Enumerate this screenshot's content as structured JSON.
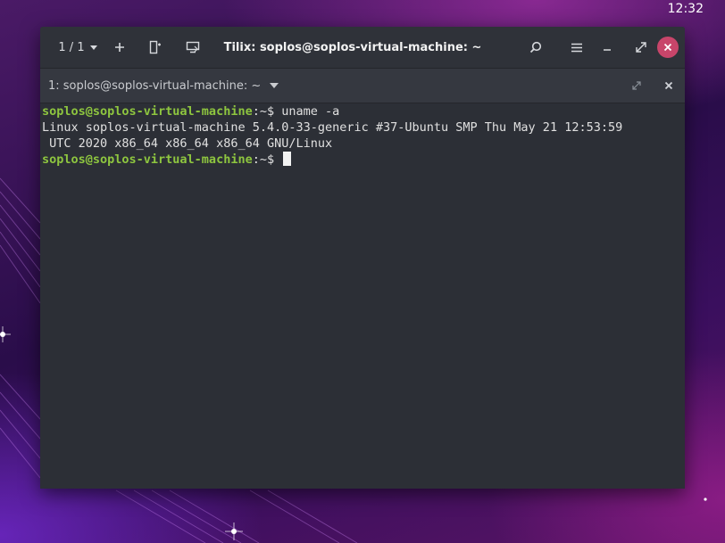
{
  "desktop": {
    "clock": "12:32"
  },
  "titlebar": {
    "session_count": "1 / 1",
    "title": "Tilix: soplos@soplos-virtual-machine: ~"
  },
  "terminal_header": {
    "title": "1: soplos@soplos-virtual-machine: ~"
  },
  "terminal": {
    "prompt_user_host": "soplos@soplos-virtual-machine",
    "prompt_suffix": ":~$",
    "command": " uname -a",
    "output_line_1": "Linux soplos-virtual-machine 5.4.0-33-generic #37-Ubuntu SMP Thu May 21 12:53:59",
    "output_line_2": " UTC 2020 x86_64 x86_64 x86_64 GNU/Linux"
  },
  "colors": {
    "prompt_green": "#8ec63f",
    "close_button": "#c8456a",
    "terminal_bg": "#2c2f36"
  },
  "icons": {
    "add": "plus-icon",
    "split": "split-terminal-icon",
    "sync": "sync-input-icon",
    "search": "search-icon",
    "menu": "hamburger-menu-icon",
    "minimize": "minimize-icon",
    "maximize": "maximize-icon",
    "close": "close-icon"
  }
}
